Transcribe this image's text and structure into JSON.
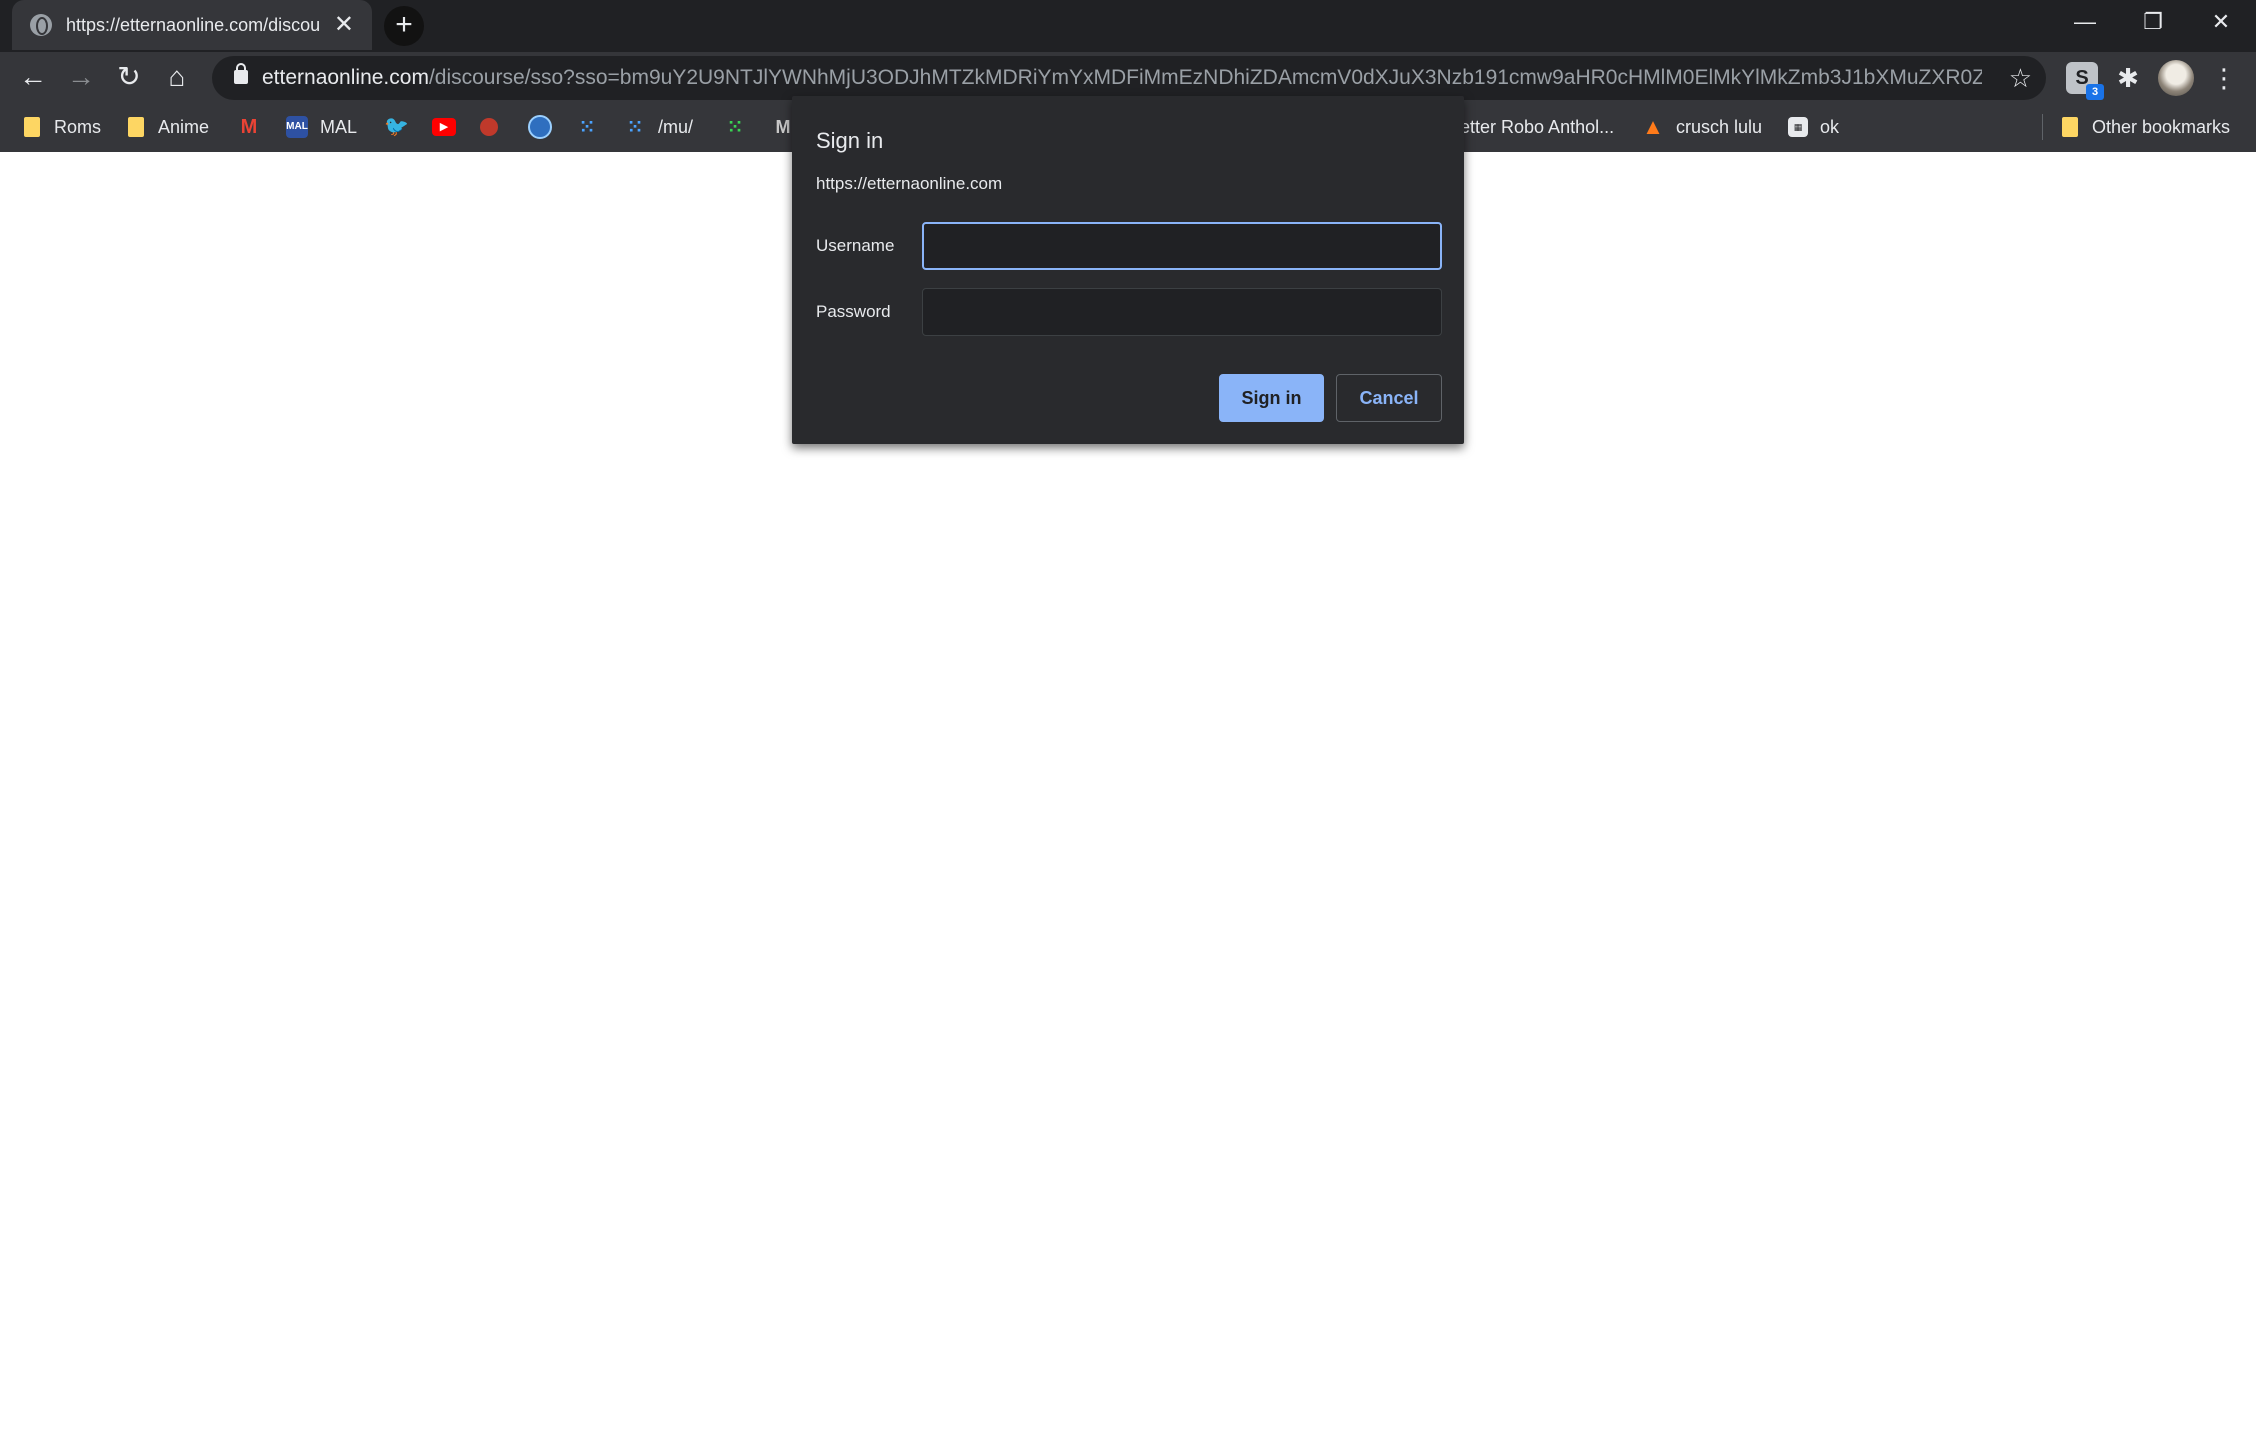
{
  "tab": {
    "title": "https://etternaonline.com/discou",
    "close": "✕"
  },
  "window": {
    "new_tab": "+",
    "minimize": "—",
    "restore": "❐",
    "close": "✕"
  },
  "toolbar": {
    "back": "←",
    "forward": "→",
    "reload": "↻",
    "home": "⌂",
    "url_host": "etternaonline.com",
    "url_rest": "/discourse/sso?sso=bm9uY2U9NTJlYWNhMjU3ODJhMTZkMDRiYmYxMDFiMmEzNDhiZDAmcmV0dXJuX3Nzb191cmw9aHR0cHMlM0ElMkYlMkZmb3J1bXMuZXR0ZXJu...",
    "star": "☆",
    "extension_badge": "3",
    "puzzle": "✱",
    "menu": "⋮"
  },
  "bookmarks": {
    "roms": "Roms",
    "anime": "Anime",
    "mal": "MAL",
    "mu": "/mu/",
    "getter": "etter Robo Anthol...",
    "crusch": "crusch lulu",
    "ok": "ok",
    "other": "Other bookmarks"
  },
  "dialog": {
    "title": "Sign in",
    "origin": "https://etternaonline.com",
    "username_label": "Username",
    "password_label": "Password",
    "username_value": "",
    "password_value": "",
    "sign_in": "Sign in",
    "cancel": "Cancel"
  },
  "colors": {
    "accent": "#8ab4f8",
    "chrome_dark": "#35363a",
    "frame": "#202124",
    "dialog_bg": "#292a2d"
  }
}
